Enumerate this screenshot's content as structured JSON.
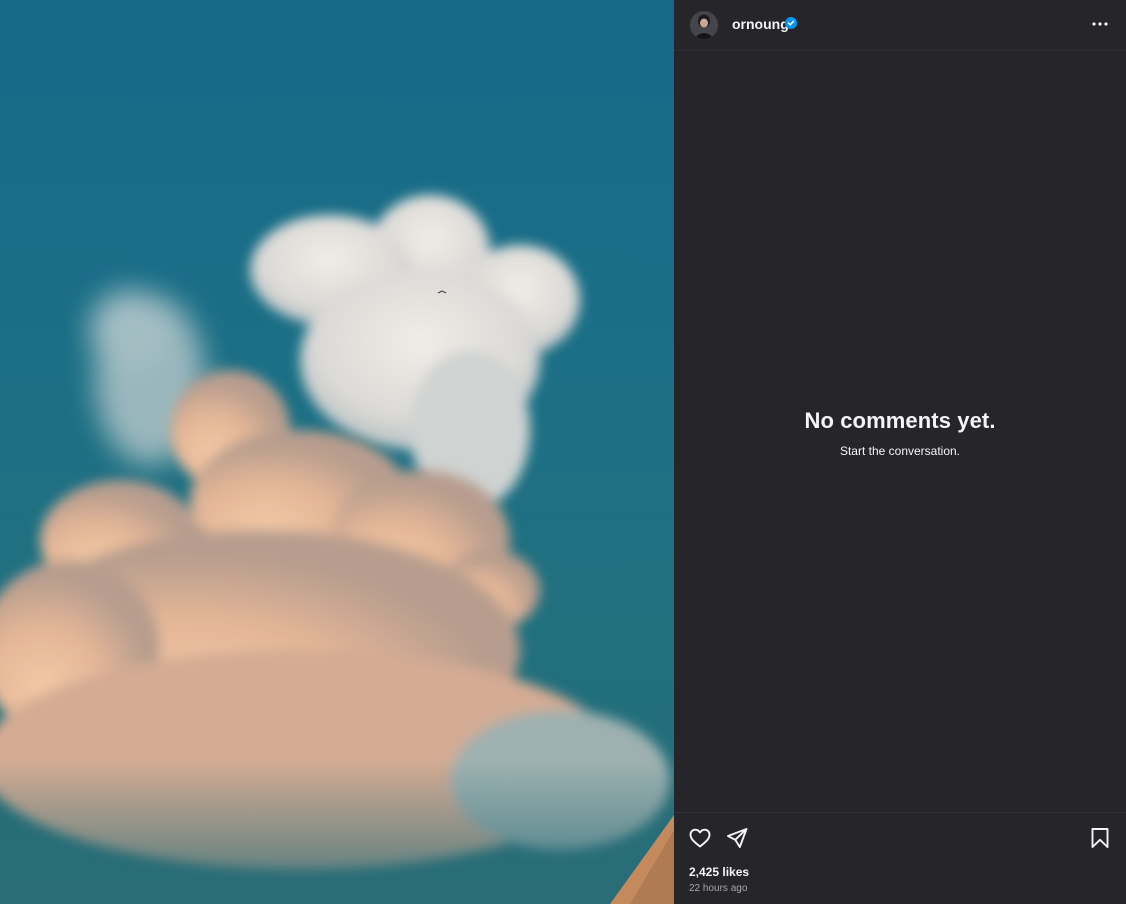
{
  "post": {
    "username": "ornoung",
    "verified": true,
    "more_icon": "more-horizontal-icon"
  },
  "comments": {
    "empty_title": "No comments yet.",
    "empty_subtitle": "Start the conversation."
  },
  "actions": {
    "like_icon": "heart-icon",
    "share_icon": "paper-plane-icon",
    "save_icon": "bookmark-icon"
  },
  "stats": {
    "likes_text": "2,425 likes",
    "time_text": "22 hours ago"
  },
  "colors": {
    "panel_bg": "#25252a",
    "text_primary": "#f5f5f5",
    "text_secondary": "#a8a8a8",
    "verified_blue": "#0095f6",
    "sky": "#166a88"
  }
}
